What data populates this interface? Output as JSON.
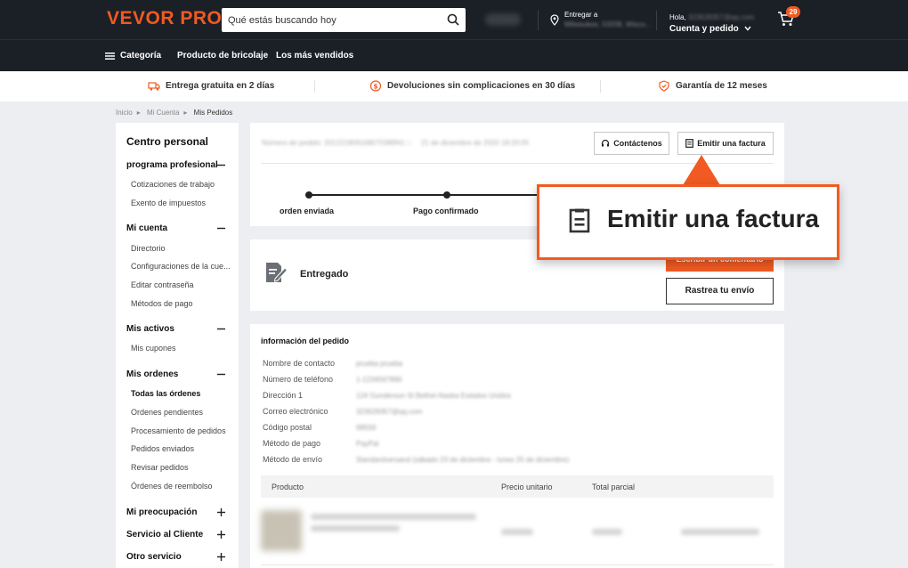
{
  "header": {
    "logo": "VEVOR PRO",
    "search_placeholder": "Qué estás buscando hoy",
    "deliver_label": "Entregar a",
    "deliver_value": "Milwaukee, 53208, Wisco...",
    "greeting": "Hola, ",
    "account_email": "323628357@qq.com",
    "account_cta": "Cuenta y pedido",
    "cart_count": "29"
  },
  "nav": {
    "category": "Categoría",
    "diy": "Producto de bricolaje",
    "bestsellers": "Los más vendidos"
  },
  "benefits": [
    "Entrega gratuita en 2 días",
    "Devoluciones sin complicaciones en 30 días",
    "Garantía de 12 meses"
  ],
  "breadcrumb": [
    "Inicio",
    "Mi Cuenta",
    "Mis Pedidos"
  ],
  "sidebar": {
    "title": "Centro personal",
    "groups": [
      {
        "label": "programa profesional",
        "items": [
          "Cotizaciones de trabajo",
          "Exento de impuestos"
        ]
      },
      {
        "label": "Mi cuenta",
        "items": [
          "Directorio",
          "Configuraciones de la cue...",
          "Editar contraseña",
          "Métodos de pago"
        ]
      },
      {
        "label": "Mis activos",
        "items": [
          "Mis cupones"
        ]
      },
      {
        "label": "Mis ordenes",
        "items": [
          "Todas las órdenes",
          "Ordenes pendientes",
          "Procesamiento de pedidos",
          "Pedidos enviados",
          "Revisar pedidos",
          "Órdenes de reembolso"
        ]
      },
      {
        "label": "Mi preocupación",
        "items": []
      },
      {
        "label": "Servicio al Cliente",
        "items": []
      },
      {
        "label": "Otro servicio",
        "items": []
      }
    ]
  },
  "order": {
    "number_text": "Número de pedido: 201221809168070389N1",
    "date_text": "21 de diciembre de 2020 18:20:05",
    "contact_button": "Contáctenos",
    "invoice_button": "Emitir una factura",
    "steps": [
      "orden enviada",
      "Pago confirmado"
    ]
  },
  "status": {
    "label": "Entregado",
    "review_button": "Escribir un comentario",
    "track_button": "Rastrea tu envío"
  },
  "info": {
    "title": "información del pedido",
    "rows": [
      {
        "label": "Nombre de contacto",
        "value": "prueba prueba"
      },
      {
        "label": "Número de teléfono",
        "value": "1-1234567890"
      },
      {
        "label": "Dirección 1",
        "value": "124 Gunderson St Bethel Alaska Estados Unidos"
      },
      {
        "label": "Correo electrónico",
        "value": "323628357@qq.com"
      },
      {
        "label": "Código postal",
        "value": "99559"
      },
      {
        "label": "Método de pago",
        "value": "PayPal"
      },
      {
        "label": "Método de envío",
        "value": "Standardversand (sábado 23 de diciembre - lunes 25 de diciembre)"
      }
    ],
    "columns": [
      "Producto",
      "Precio unitario",
      "Total parcial"
    ]
  },
  "callout": {
    "text": "Emitir una factura"
  },
  "colors": {
    "accent": "#f15a22",
    "header_bg": "#1b1f26",
    "page_bg": "#eceef1"
  }
}
